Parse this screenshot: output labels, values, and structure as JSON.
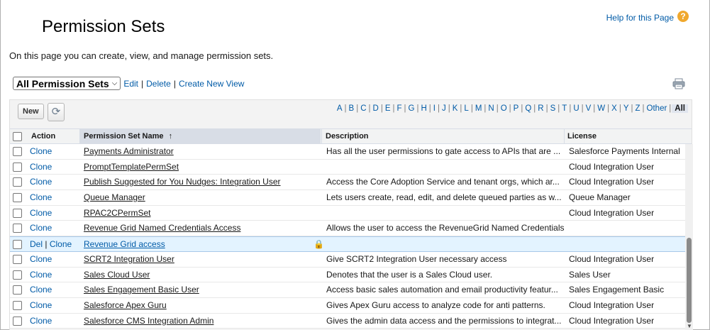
{
  "page": {
    "title": "Permission Sets",
    "help_label": "Help for this Page",
    "intro": "On this page you can create, view, and manage permission sets."
  },
  "view": {
    "selected": "All Permission Sets",
    "links": [
      "Edit",
      "Delete",
      "Create New View"
    ]
  },
  "toolbar": {
    "new_label": "New",
    "refresh_icon": "refresh-icon",
    "print_icon": "printer-icon"
  },
  "alpha": [
    "A",
    "B",
    "C",
    "D",
    "E",
    "F",
    "G",
    "H",
    "I",
    "J",
    "K",
    "L",
    "M",
    "N",
    "O",
    "P",
    "Q",
    "R",
    "S",
    "T",
    "U",
    "V",
    "W",
    "X",
    "Y",
    "Z",
    "Other",
    "All"
  ],
  "alpha_active": "All",
  "columns": {
    "action": "Action",
    "name": "Permission Set Name",
    "sort_indicator": "↑",
    "description": "Description",
    "license": "License"
  },
  "rows": [
    {
      "action": [
        "Clone"
      ],
      "name": "Payments Administrator",
      "description": "Has all the user permissions to gate access to APIs that are ...",
      "license": "Salesforce Payments Internal"
    },
    {
      "action": [
        "Clone"
      ],
      "name": "PromptTemplatePermSet",
      "description": "",
      "license": "Cloud Integration User"
    },
    {
      "action": [
        "Clone"
      ],
      "name": "Publish Suggested for You Nudges: Integration User",
      "description": "Access the Core Adoption Service and tenant orgs, which ar...",
      "license": "Cloud Integration User"
    },
    {
      "action": [
        "Clone"
      ],
      "name": "Queue Manager",
      "description": "Lets users create, read, edit, and delete queued parties as w...",
      "license": "Queue Manager"
    },
    {
      "action": [
        "Clone"
      ],
      "name": "RPAC2CPermSet",
      "description": "",
      "license": "Cloud Integration User"
    },
    {
      "action": [
        "Clone"
      ],
      "name": "Revenue Grid Named Credentials Access",
      "description": "Allows the user to access the RevenueGrid Named Credentials",
      "license": ""
    },
    {
      "action": [
        "Del",
        "Clone"
      ],
      "name": "Revenue Grid access",
      "description": "",
      "license": "",
      "locked": true,
      "selected": true
    },
    {
      "action": [
        "Clone"
      ],
      "name": "SCRT2 Integration User",
      "description": "Give SCRT2 Integration User necessary access",
      "license": "Cloud Integration User"
    },
    {
      "action": [
        "Clone"
      ],
      "name": "Sales Cloud User",
      "description": "Denotes that the user is a Sales Cloud user.",
      "license": "Sales User"
    },
    {
      "action": [
        "Clone"
      ],
      "name": "Sales Engagement Basic User",
      "description": "Access basic sales automation and email productivity featur...",
      "license": "Sales Engagement Basic"
    },
    {
      "action": [
        "Clone"
      ],
      "name": "Salesforce Apex Guru",
      "description": "Gives Apex Guru access to analyze code for anti patterns.",
      "license": "Cloud Integration User"
    },
    {
      "action": [
        "Clone"
      ],
      "name": "Salesforce CMS Integration Admin",
      "description": "Gives the admin data access and the permissions to integrat...",
      "license": "Cloud Integration User"
    }
  ],
  "colors": {
    "link": "#015ba7",
    "help": "#f0a82d",
    "selected_row": "#e3f3ff"
  }
}
